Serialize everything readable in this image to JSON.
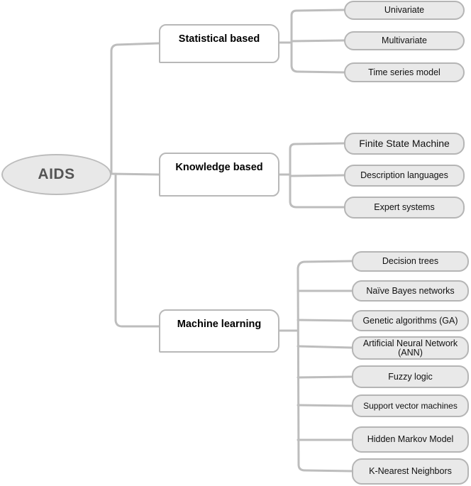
{
  "diagram": {
    "title": "AIDS",
    "root": {
      "label": "AIDS"
    },
    "colors": {
      "connector": "#bdbdbd",
      "root_fill": "#e8e8e8",
      "leaf_fill": "#e9e9e9",
      "root_text": "#555555"
    },
    "categories": [
      {
        "label": "Statistical based",
        "children": [
          "Univariate",
          "Multivariate",
          "Time series model"
        ]
      },
      {
        "label": "Knowledge based",
        "children": [
          "Finite State Machine",
          "Description languages",
          "Expert systems"
        ]
      },
      {
        "label": "Machine learning",
        "children": [
          "Decision trees",
          "Naïve Bayes networks",
          "Genetic algorithms (GA)",
          "Artificial Neural Network (ANN)",
          "Fuzzy logic",
          "Support vector machines",
          "Hidden Markov Model",
          "K-Nearest Neighbors"
        ]
      }
    ]
  }
}
